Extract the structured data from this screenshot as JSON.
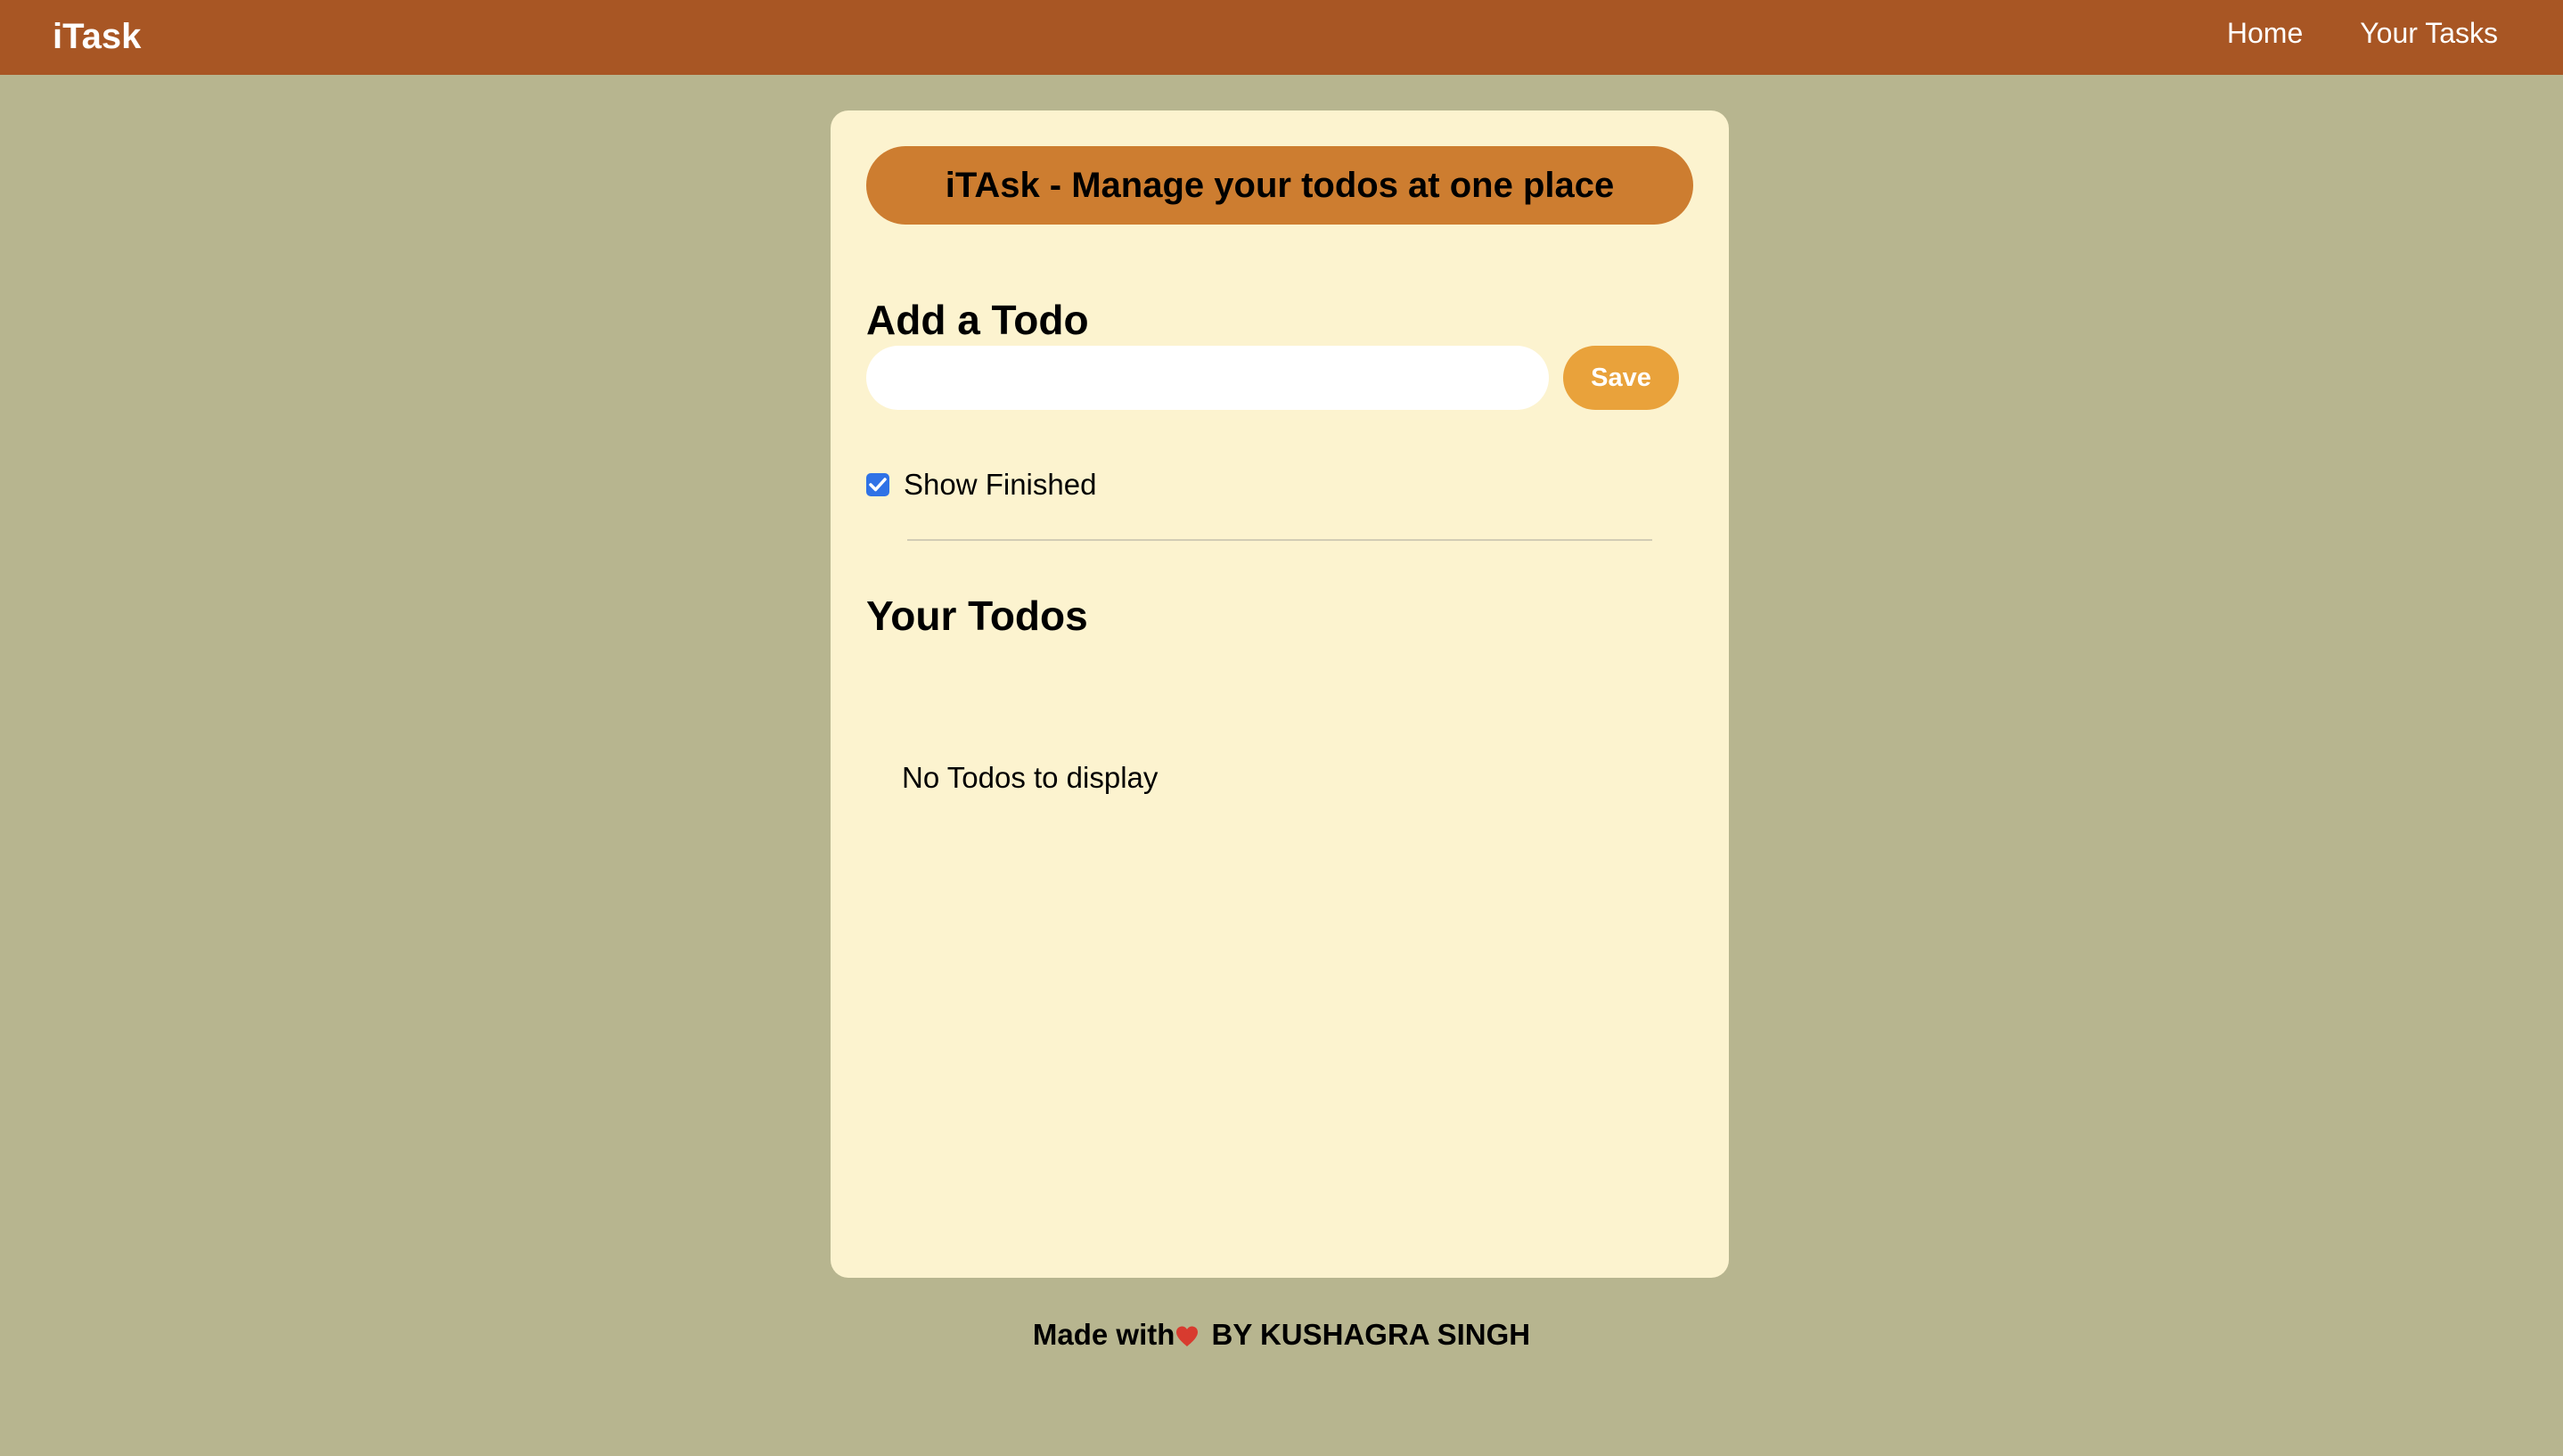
{
  "navbar": {
    "brand": "iTask",
    "links": [
      "Home",
      "Your Tasks"
    ]
  },
  "card": {
    "banner": "iTAsk - Manage your todos at one place",
    "add_heading": "Add a Todo",
    "todo_input": {
      "value": "",
      "placeholder": ""
    },
    "save_label": "Save",
    "show_finished": {
      "label": "Show Finished",
      "checked": true
    },
    "todos_heading": "Your Todos",
    "empty_message": "No Todos to display"
  },
  "footer": {
    "before": "Made with",
    "icon": "heart-icon",
    "after": " BY KUSHAGRA SINGH"
  },
  "colors": {
    "page_background": "#b7b58f",
    "navbar": "#a85624",
    "card": "#fcf3cf",
    "banner": "#cd7d30",
    "save_button": "#e9a23b",
    "checkbox": "#2f72e6",
    "heart": "#d83b2f"
  }
}
